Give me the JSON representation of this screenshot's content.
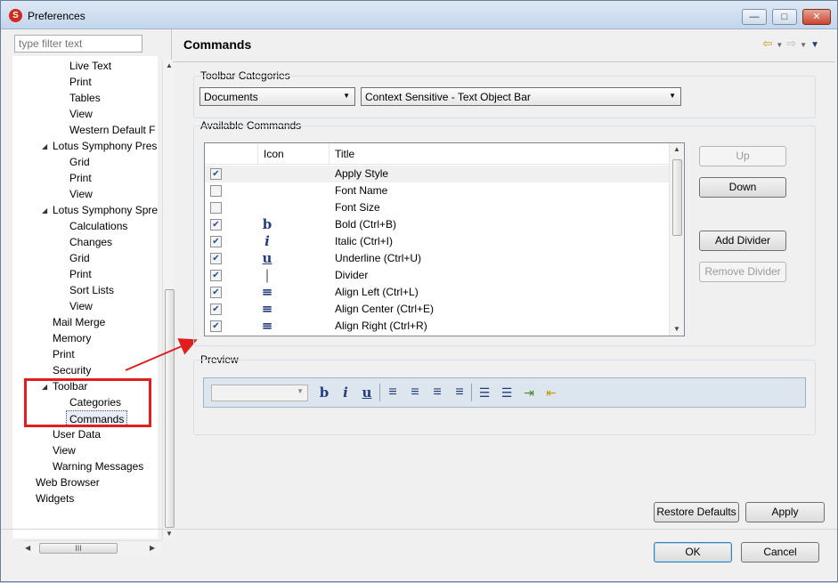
{
  "window": {
    "title": "Preferences",
    "controls": [
      "minimize",
      "maximize",
      "close"
    ]
  },
  "filter": {
    "placeholder": "type filter text"
  },
  "tree": {
    "items": [
      {
        "label": "Live Text",
        "level": 2
      },
      {
        "label": "Print",
        "level": 2
      },
      {
        "label": "Tables",
        "level": 2
      },
      {
        "label": "View",
        "level": 2
      },
      {
        "label": "Western Default F",
        "level": 2
      },
      {
        "label": "Lotus Symphony Pres",
        "level": 1,
        "expanded": true
      },
      {
        "label": "Grid",
        "level": 2
      },
      {
        "label": "Print",
        "level": 2
      },
      {
        "label": "View",
        "level": 2
      },
      {
        "label": "Lotus Symphony Spre",
        "level": 1,
        "expanded": true
      },
      {
        "label": "Calculations",
        "level": 2
      },
      {
        "label": "Changes",
        "level": 2
      },
      {
        "label": "Grid",
        "level": 2
      },
      {
        "label": "Print",
        "level": 2
      },
      {
        "label": "Sort Lists",
        "level": 2
      },
      {
        "label": "View",
        "level": 2
      },
      {
        "label": "Mail Merge",
        "level": 1
      },
      {
        "label": "Memory",
        "level": 1
      },
      {
        "label": "Print",
        "level": 1
      },
      {
        "label": "Security",
        "level": 1
      },
      {
        "label": "Toolbar",
        "level": 1,
        "expanded": true
      },
      {
        "label": "Categories",
        "level": 2
      },
      {
        "label": "Commands",
        "level": 2,
        "selected": true
      },
      {
        "label": "User Data",
        "level": 1
      },
      {
        "label": "View",
        "level": 1
      },
      {
        "label": "Warning Messages",
        "level": 1
      },
      {
        "label": "Web Browser",
        "level": 0
      },
      {
        "label": "Widgets",
        "level": 0
      }
    ],
    "hscroll_thumb_label": "III"
  },
  "page": {
    "title": "Commands"
  },
  "toolbar_categories": {
    "label": "Toolbar Categories",
    "category_value": "Documents",
    "bar_value": "Context Sensitive - Text Object Bar"
  },
  "available_commands": {
    "label": "Available Commands",
    "columns": [
      "Icon",
      "Title"
    ],
    "rows": [
      {
        "checked": true,
        "icon": "apply-style-icon",
        "glyph": "",
        "title": "Apply Style",
        "selected": true
      },
      {
        "checked": false,
        "icon": "",
        "glyph": "",
        "title": "Font Name"
      },
      {
        "checked": false,
        "icon": "",
        "glyph": "",
        "title": "Font Size"
      },
      {
        "checked": true,
        "icon": "bold-icon",
        "glyph": "b",
        "title": "Bold (Ctrl+B)"
      },
      {
        "checked": true,
        "icon": "italic-icon",
        "glyph": "i",
        "title": "Italic (Ctrl+I)"
      },
      {
        "checked": true,
        "icon": "underline-icon",
        "glyph": "u",
        "title": "Underline (Ctrl+U)"
      },
      {
        "checked": true,
        "icon": "divider-icon",
        "glyph": "|",
        "title": "Divider"
      },
      {
        "checked": true,
        "icon": "align-left-icon",
        "glyph": "≡",
        "title": "Align Left (Ctrl+L)"
      },
      {
        "checked": true,
        "icon": "align-center-icon",
        "glyph": "≡",
        "title": "Align Center (Ctrl+E)"
      },
      {
        "checked": true,
        "icon": "align-right-icon",
        "glyph": "≡",
        "title": "Align Right (Ctrl+R)"
      }
    ]
  },
  "side_buttons": {
    "up": "Up",
    "down": "Down",
    "add_divider": "Add Divider",
    "remove_divider": "Remove Divider"
  },
  "preview": {
    "label": "Preview",
    "tools": [
      "b",
      "i",
      "u",
      "≡",
      "≡",
      "≡",
      "≡",
      "☰",
      "☰",
      "⇥",
      "⇤"
    ]
  },
  "footer": {
    "restore_defaults": "Restore Defaults",
    "apply": "Apply",
    "ok": "OK",
    "cancel": "Cancel"
  }
}
